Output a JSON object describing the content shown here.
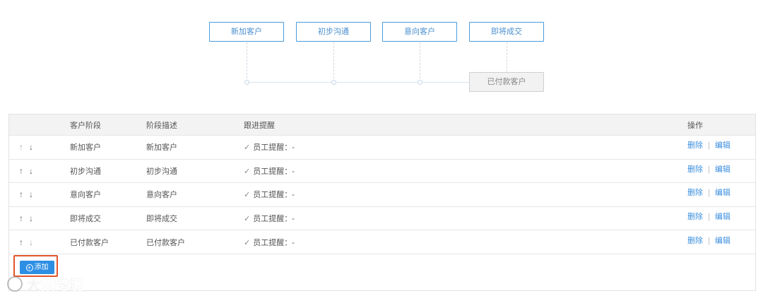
{
  "flow": {
    "stages": [
      "新加客户",
      "初步沟通",
      "意向客户",
      "即将成交"
    ],
    "final_stage": "已付款客户"
  },
  "table": {
    "headers": {
      "arrows": "",
      "stage": "客户阶段",
      "desc": "阶段描述",
      "remind": "跟进提醒",
      "ops": "操作"
    },
    "rows": [
      {
        "stage": "新加客户",
        "desc": "新加客户",
        "remind": "员工提醒：-"
      },
      {
        "stage": "初步沟通",
        "desc": "初步沟通",
        "remind": "员工提醒：-"
      },
      {
        "stage": "意向客户",
        "desc": "意向客户",
        "remind": "员工提醒：-"
      },
      {
        "stage": "即将成交",
        "desc": "即将成交",
        "remind": "员工提醒：-"
      },
      {
        "stage": "已付款客户",
        "desc": "已付款客户",
        "remind": "员工提醒：-"
      }
    ],
    "up_arrow": "↑",
    "down_arrow": "↓",
    "check_glyph": "✓",
    "delete_label": "删除",
    "edit_label": "编辑",
    "separator": "|"
  },
  "add_button": {
    "label": "添加",
    "icon": "plus-circle-icon"
  },
  "watermark": {
    "text": "大数跨境"
  },
  "colors": {
    "accent": "#2d8fe4",
    "link": "#3d8fe0",
    "highlight": "#e0562b"
  }
}
